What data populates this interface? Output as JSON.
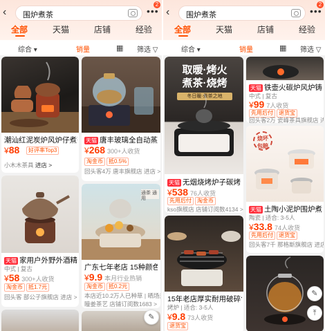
{
  "panels": [
    {
      "search": "围炉煮茶",
      "badge": "2",
      "tabs": [
        "全部",
        "天猫",
        "店铺",
        "经验"
      ],
      "filter": {
        "sort": "综合 ▾",
        "sales": "销量",
        "filter": "筛选 ▽"
      },
      "cards": [
        {
          "title": "潮汕红泥炭炉风炉仔煮茶器",
          "price_sym": "¥",
          "price": "88",
          "sold": "",
          "tags": [
            "好评率Top3"
          ],
          "shop": "小木木茶具",
          "enter": "进店 >",
          "tmall": false
        },
        {
          "title": "唐丰玻璃全自动蒸汽套",
          "price_sym": "¥",
          "price": "268",
          "sold": "300+人收货",
          "tags": [
            "淘金币",
            "抵0.5%"
          ],
          "shop": "回头客4万 唐丰旗舰店 进店 >",
          "enter": "",
          "tmall": true
        },
        {
          "title": "家用户外野外酒精灯炉",
          "sub": "中式 | 复古",
          "price_sym": "¥",
          "price": "58",
          "sold": "300+人收货",
          "tags": [
            "淘金币",
            "抵1.7元"
          ],
          "shop": "回头客 部公子旗舰店 进店 >",
          "enter": "",
          "tmall": true
        },
        {
          "title": "广东七年老店 15种颜色潮",
          "price_sym": "¥",
          "price": "9.9",
          "sold": "本月行业热销",
          "tags": [
            "淘金币",
            "抵0.2元"
          ],
          "shop": "本店近10.2万人已种草 | 晒场热",
          "shop2": "瞳姜茶艺 店铺订阅数1683 >",
          "enter": "",
          "tmall": false
        }
      ],
      "image_labels": [
        "通茶 通用"
      ]
    },
    {
      "search": "围炉煮茶",
      "badge": "2",
      "tabs": [
        "全部",
        "天猫",
        "店铺",
        "经验"
      ],
      "filter": {
        "sort": "综合 ▾",
        "sales": "销量",
        "filter": "筛选 ▽"
      },
      "cards": [
        {
          "title": "铁壶火碳炉风炉铸铁",
          "sub": "中式 | 复古",
          "price_sym": "¥",
          "price": "99",
          "sold": "7人收货",
          "tags": [
            "先用后付",
            "退货宝"
          ],
          "shop": "回头客2万 瓷峰茶具旗舰店 进店 >",
          "enter": "",
          "tmall": true
        },
        {
          "title": "无烟烧烤炉子碳烤炉别",
          "price_sym": "¥",
          "price": "538",
          "sold": "76人收货",
          "tags": [
            "先用后付",
            "淘金币"
          ],
          "shop": "kso旗舰店 店铺订阅数4134 >",
          "enter": "",
          "tmall": true
        },
        {
          "title": "土陶小泥炉围炉煮茶烤",
          "sub": "陶瓷 | 适合: 3-5人",
          "price_sym": "¥",
          "price": "33.8",
          "sold": "74人收货",
          "tags": [
            "先用后付",
            "退货宝"
          ],
          "shop": "回头客7千 那格斯旗舰店 进店 >",
          "enter": "",
          "tmall": true
        },
        {
          "title": "15年老店厚实耐用破碎包赔",
          "sub": "烤炉 | 适合: 3-5人",
          "price_sym": "¥",
          "price": "9.8",
          "sold": "73人收货",
          "tags": [
            "退货宝"
          ],
          "shop": "",
          "enter": "",
          "tmall": false
        }
      ],
      "image_labels": [
        "取暖·烤火",
        "煮茶·烧烤",
        "冬日暖·煮茶之地",
        "烧坏",
        "包赔"
      ]
    }
  ],
  "colors": {
    "accent": "#ff5000",
    "price": "#ff3d00",
    "tmall": "#ff2d3a"
  }
}
